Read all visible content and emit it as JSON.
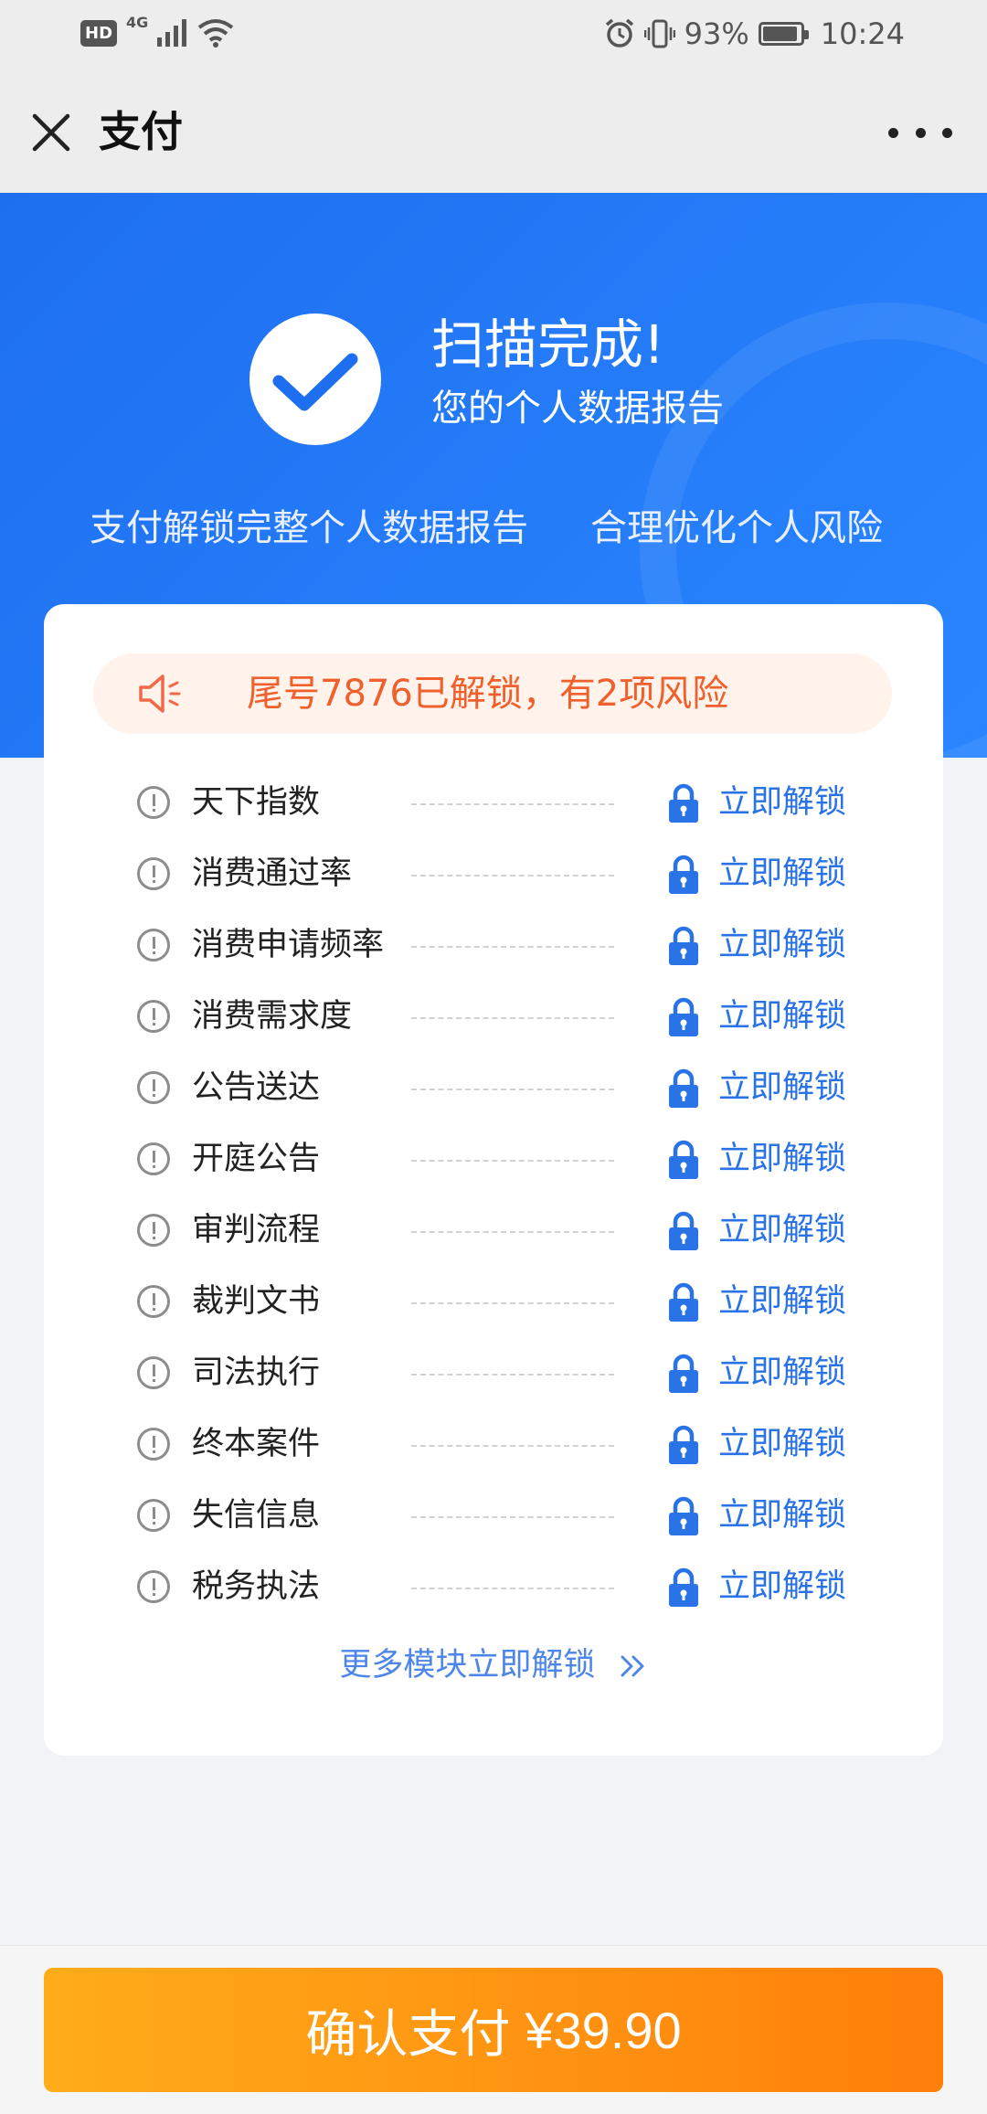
{
  "status_bar": {
    "hd": "HD",
    "network": "4G",
    "battery": "93%",
    "battery_level": 0.93,
    "time": "10:24"
  },
  "nav": {
    "title": "支付",
    "close_icon": "close-icon",
    "more_icon": "more-icon"
  },
  "hero": {
    "title": "扫描完成!",
    "subtitle": "您的个人数据报告",
    "slogan_left": "支付解锁完整个人数据报告",
    "slogan_right": "合理优化个人风险"
  },
  "notice": {
    "text": "尾号7876已解锁，有2项风险",
    "icon": "speaker-icon"
  },
  "risk_items": [
    {
      "name": "天下指数",
      "action": "立即解锁"
    },
    {
      "name": "消费通过率",
      "action": "立即解锁"
    },
    {
      "name": "消费申请频率",
      "action": "立即解锁"
    },
    {
      "name": "消费需求度",
      "action": "立即解锁"
    },
    {
      "name": "公告送达",
      "action": "立即解锁"
    },
    {
      "name": "开庭公告",
      "action": "立即解锁"
    },
    {
      "name": "审判流程",
      "action": "立即解锁"
    },
    {
      "name": "裁判文书",
      "action": "立即解锁"
    },
    {
      "name": "司法执行",
      "action": "立即解锁"
    },
    {
      "name": "终本案件",
      "action": "立即解锁"
    },
    {
      "name": "失信信息",
      "action": "立即解锁"
    },
    {
      "name": "税务执法",
      "action": "立即解锁"
    }
  ],
  "more_modules": {
    "label": "更多模块立即解锁"
  },
  "pay": {
    "label": "确认支付",
    "amount": "¥39.90"
  },
  "colors": {
    "primary_blue": "#2a73e6",
    "hero_blue": "#1e6ff0",
    "notice_orange": "#f0602d",
    "pay_gradient_start": "#ffac1a",
    "pay_gradient_end": "#ff7f0a"
  }
}
